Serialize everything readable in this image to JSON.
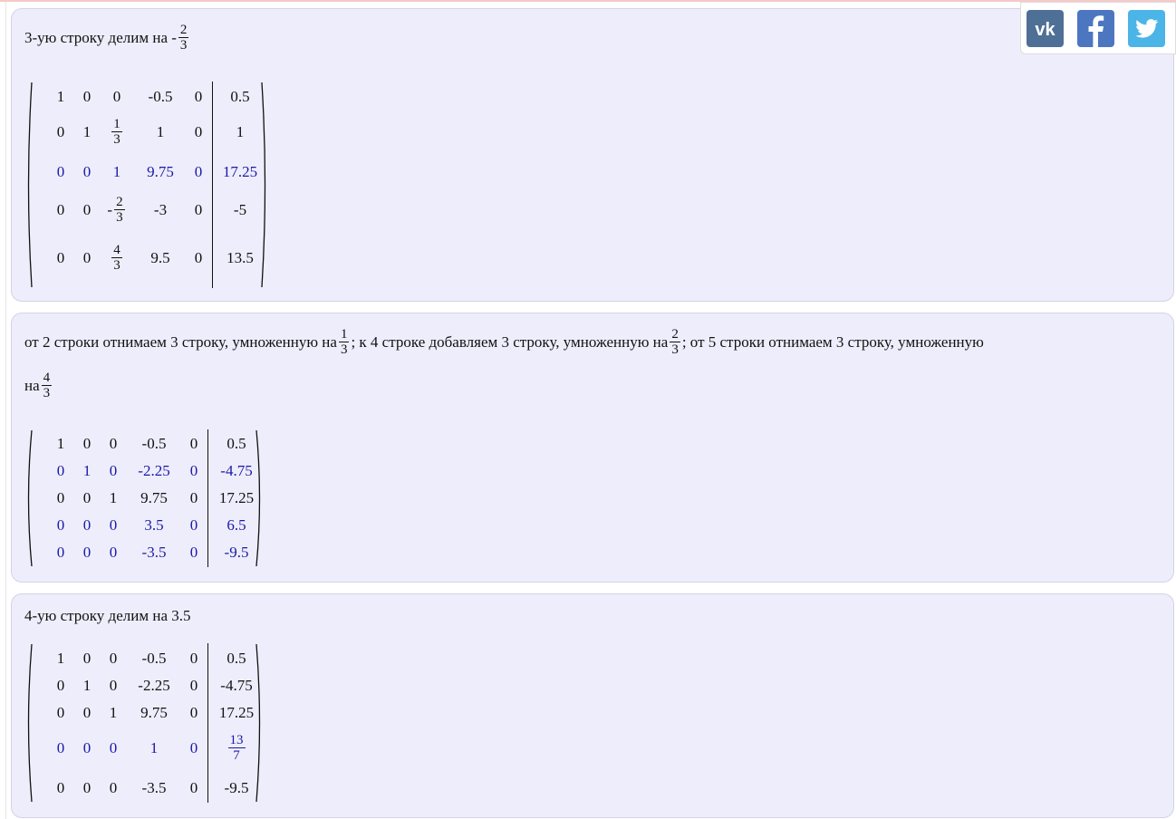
{
  "steps": [
    {
      "text_before": "3-ую строку делим на -",
      "fraction": {
        "num": "2",
        "den": "3"
      },
      "matrix": {
        "rows": [
          [
            {
              "v": "1"
            },
            {
              "v": "0"
            },
            {
              "v": "0"
            },
            {
              "v": "-0.5"
            },
            {
              "v": "0"
            },
            {
              "v": "0.5"
            }
          ],
          [
            {
              "v": "0"
            },
            {
              "v": "1"
            },
            {
              "num": "1",
              "den": "3"
            },
            {
              "v": "1"
            },
            {
              "v": "0"
            },
            {
              "v": "1"
            }
          ],
          [
            {
              "v": "0"
            },
            {
              "v": "0"
            },
            {
              "v": "1"
            },
            {
              "v": "9.75"
            },
            {
              "v": "0"
            },
            {
              "v": "17.25"
            }
          ],
          [
            {
              "v": "0"
            },
            {
              "v": "0"
            },
            {
              "sign": "-",
              "num": "2",
              "den": "3"
            },
            {
              "v": "-3"
            },
            {
              "v": "0"
            },
            {
              "v": "-5"
            }
          ],
          [
            {
              "v": "0"
            },
            {
              "v": "0"
            },
            {
              "num": "4",
              "den": "3"
            },
            {
              "v": "9.5"
            },
            {
              "v": "0"
            },
            {
              "v": "13.5"
            }
          ]
        ],
        "highlighted_rows": [
          2
        ]
      }
    },
    {
      "parts": [
        "от 2 строки отнимаем 3 строку, умноженную на ",
        "; к 4 строке добавляем 3 строку, умноженную на ",
        "; от 5 строки отнимаем 3 строку, умноженную",
        "на "
      ],
      "fractions": [
        {
          "num": "1",
          "den": "3"
        },
        {
          "num": "2",
          "den": "3"
        },
        {
          "num": "4",
          "den": "3"
        }
      ],
      "matrix": {
        "rows": [
          [
            {
              "v": "1"
            },
            {
              "v": "0"
            },
            {
              "v": "0"
            },
            {
              "v": "-0.5"
            },
            {
              "v": "0"
            },
            {
              "v": "0.5"
            }
          ],
          [
            {
              "v": "0"
            },
            {
              "v": "1"
            },
            {
              "v": "0"
            },
            {
              "v": "-2.25"
            },
            {
              "v": "0"
            },
            {
              "v": "-4.75"
            }
          ],
          [
            {
              "v": "0"
            },
            {
              "v": "0"
            },
            {
              "v": "1"
            },
            {
              "v": "9.75"
            },
            {
              "v": "0"
            },
            {
              "v": "17.25"
            }
          ],
          [
            {
              "v": "0"
            },
            {
              "v": "0"
            },
            {
              "v": "0"
            },
            {
              "v": "3.5"
            },
            {
              "v": "0"
            },
            {
              "v": "6.5"
            }
          ],
          [
            {
              "v": "0"
            },
            {
              "v": "0"
            },
            {
              "v": "0"
            },
            {
              "v": "-3.5"
            },
            {
              "v": "0"
            },
            {
              "v": "-9.5"
            }
          ]
        ],
        "highlighted_rows": [
          1,
          3,
          4
        ]
      }
    },
    {
      "text": "4-ую строку делим на 3.5",
      "matrix": {
        "rows": [
          [
            {
              "v": "1"
            },
            {
              "v": "0"
            },
            {
              "v": "0"
            },
            {
              "v": "-0.5"
            },
            {
              "v": "0"
            },
            {
              "v": "0.5"
            }
          ],
          [
            {
              "v": "0"
            },
            {
              "v": "1"
            },
            {
              "v": "0"
            },
            {
              "v": "-2.25"
            },
            {
              "v": "0"
            },
            {
              "v": "-4.75"
            }
          ],
          [
            {
              "v": "0"
            },
            {
              "v": "0"
            },
            {
              "v": "1"
            },
            {
              "v": "9.75"
            },
            {
              "v": "0"
            },
            {
              "v": "17.25"
            }
          ],
          [
            {
              "v": "0"
            },
            {
              "v": "0"
            },
            {
              "v": "0"
            },
            {
              "v": "1"
            },
            {
              "v": "0"
            },
            {
              "num": "13",
              "den": "7"
            }
          ],
          [
            {
              "v": "0"
            },
            {
              "v": "0"
            },
            {
              "v": "0"
            },
            {
              "v": "-3.5"
            },
            {
              "v": "0"
            },
            {
              "v": "-9.5"
            }
          ]
        ],
        "highlighted_rows": [
          3
        ]
      }
    }
  ],
  "social": {
    "buttons": [
      {
        "name": "vk",
        "icon": "vk-icon",
        "color": "#4e7096"
      },
      {
        "name": "facebook",
        "icon": "facebook-icon",
        "color": "#4d76c0"
      },
      {
        "name": "twitter",
        "icon": "twitter-icon",
        "color": "#4ab5e6"
      }
    ]
  },
  "colors": {
    "card_background": "#eeedfb",
    "card_border": "#d3d3e6",
    "highlight_text": "#1a1aa8"
  }
}
